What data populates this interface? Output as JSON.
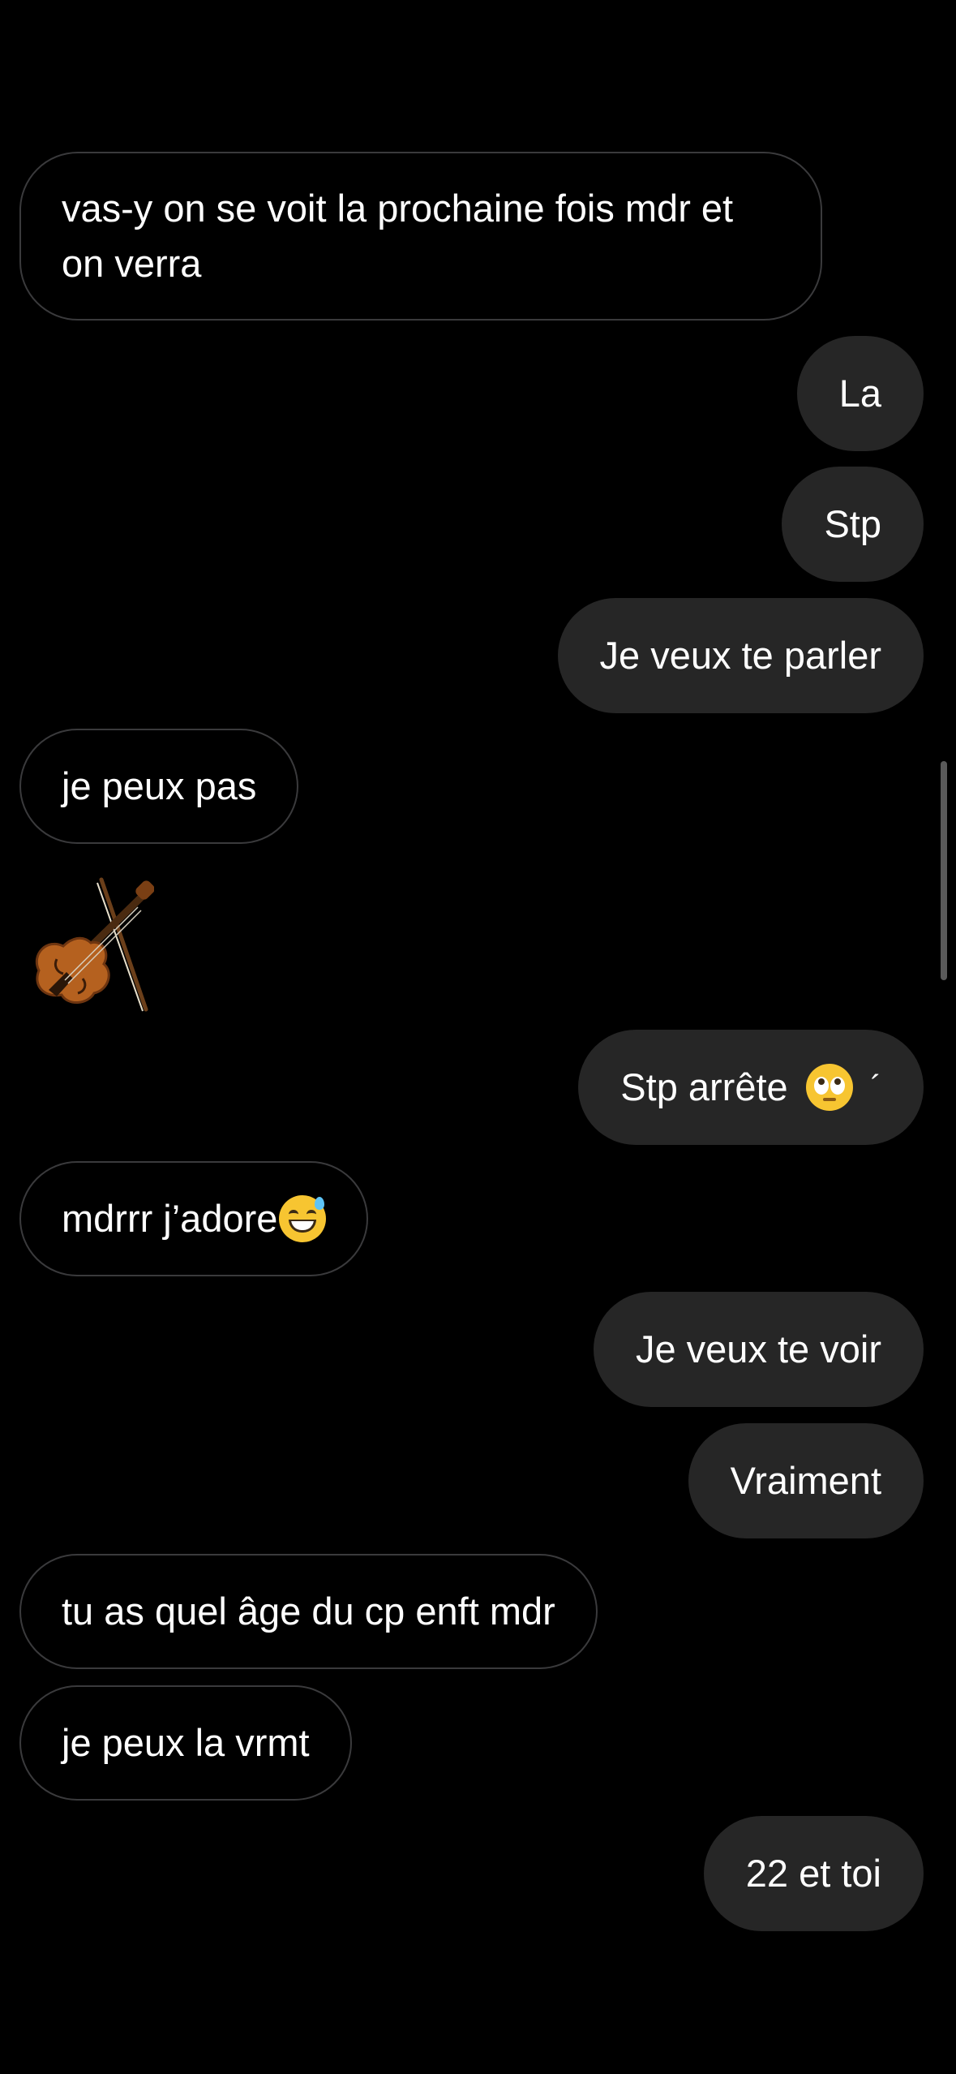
{
  "messages": [
    {
      "side": "in",
      "text": "vas-y on se voit la prochaine fois mdr et on verra"
    },
    {
      "side": "out",
      "text": "La"
    },
    {
      "side": "out",
      "text": "Stp"
    },
    {
      "side": "out",
      "text": "Je veux te parler"
    },
    {
      "side": "in",
      "text": "je peux pas"
    },
    {
      "side": "in",
      "sticker": "violin-emoji"
    },
    {
      "side": "out",
      "text": "Stp arrête",
      "emoji": "face-with-rolling-eyes-emoji",
      "suffix": "´"
    },
    {
      "side": "in",
      "text": "mdrrr j’adore",
      "emoji": "grinning-face-with-sweat-emoji"
    },
    {
      "side": "out",
      "text": "Je veux te voir"
    },
    {
      "side": "out",
      "text": "Vraiment"
    },
    {
      "side": "in",
      "text": "tu as quel âge du cp enft mdr"
    },
    {
      "side": "in",
      "text": "je peux la vrmt"
    },
    {
      "side": "out",
      "text": "22 et toi"
    }
  ],
  "colors": {
    "background": "#000000",
    "outgoing_bubble": "#262626",
    "incoming_border": "#3a3a3c",
    "text": "#ffffff"
  }
}
